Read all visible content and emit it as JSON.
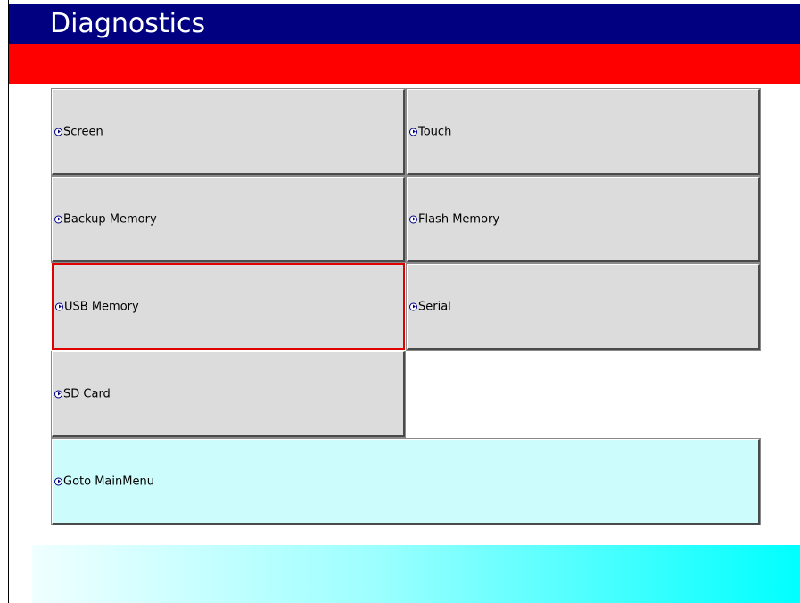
{
  "header": {
    "title": "Diagnostics"
  },
  "colors": {
    "title_bar": "#000080",
    "accent_bar": "#ff0000",
    "button_bg": "#dcdcdc",
    "main_button_bg": "#ccfcfc",
    "selected_border": "#e00000"
  },
  "menu": {
    "items": [
      {
        "label": "Screen",
        "icon": "arrow-circle-icon"
      },
      {
        "label": "Touch",
        "icon": "arrow-circle-icon"
      },
      {
        "label": "Backup Memory",
        "icon": "arrow-circle-icon"
      },
      {
        "label": "Flash Memory",
        "icon": "arrow-circle-icon"
      },
      {
        "label": "USB Memory",
        "icon": "arrow-circle-icon",
        "selected": true
      },
      {
        "label": "Serial",
        "icon": "arrow-circle-icon"
      },
      {
        "label": "SD Card",
        "icon": "arrow-circle-icon"
      }
    ],
    "main_menu_label": "Goto MainMenu"
  }
}
